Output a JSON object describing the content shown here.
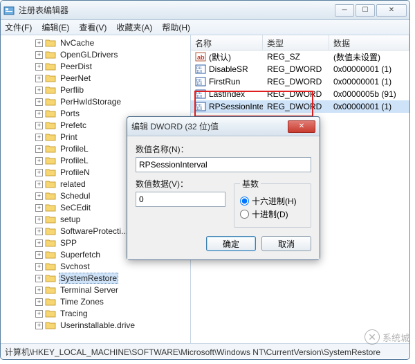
{
  "window": {
    "title": "注册表编辑器"
  },
  "menu": {
    "file": "文件(F)",
    "edit": "编辑(E)",
    "view": "查看(V)",
    "favorites": "收藏夹(A)",
    "help": "帮助(H)"
  },
  "tree": {
    "items": [
      "NvCache",
      "OpenGLDrivers",
      "PeerDist",
      "PeerNet",
      "Perflib",
      "PerHwIdStorage",
      "Ports",
      "Prefetc",
      "Print",
      "ProfileL",
      "ProfileL",
      "ProfileN",
      "related",
      "Schedul",
      "SeCEdit",
      "setup",
      "SoftwareProtecti...",
      "SPP",
      "Superfetch",
      "Svchost",
      "SystemRestore",
      "Terminal Server",
      "Time Zones",
      "Tracing",
      "Userinstallable.drive"
    ],
    "selected_index": 20
  },
  "list": {
    "columns": {
      "name": "名称",
      "type": "类型",
      "data": "数据"
    },
    "rows": [
      {
        "name": "(默认)",
        "type": "REG_SZ",
        "data": "(数值未设置)",
        "icon": "ab"
      },
      {
        "name": "DisableSR",
        "type": "REG_DWORD",
        "data": "0x00000001 (1)",
        "icon": "dw"
      },
      {
        "name": "FirstRun",
        "type": "REG_DWORD",
        "data": "0x00000001 (1)",
        "icon": "dw"
      },
      {
        "name": "LastIndex",
        "type": "REG_DWORD",
        "data": "0x0000005b (91)",
        "icon": "dw"
      },
      {
        "name": "RPSessionInter...",
        "type": "REG_DWORD",
        "data": "0x00000001 (1)",
        "icon": "dw"
      }
    ],
    "selected_index": 4
  },
  "dialog": {
    "title": "编辑 DWORD (32 位)值",
    "name_label": "数值名称(N)：",
    "name_value": "RPSessionInterval",
    "data_label": "数值数据(V)：",
    "data_value": "0",
    "base_legend": "基数",
    "radio_hex": "十六进制(H)",
    "radio_dec": "十进制(D)",
    "ok": "确定",
    "cancel": "取消"
  },
  "statusbar": {
    "path": "计算机\\HKEY_LOCAL_MACHINE\\SOFTWARE\\Microsoft\\Windows NT\\CurrentVersion\\SystemRestore"
  },
  "watermark": {
    "text": "系统城"
  }
}
